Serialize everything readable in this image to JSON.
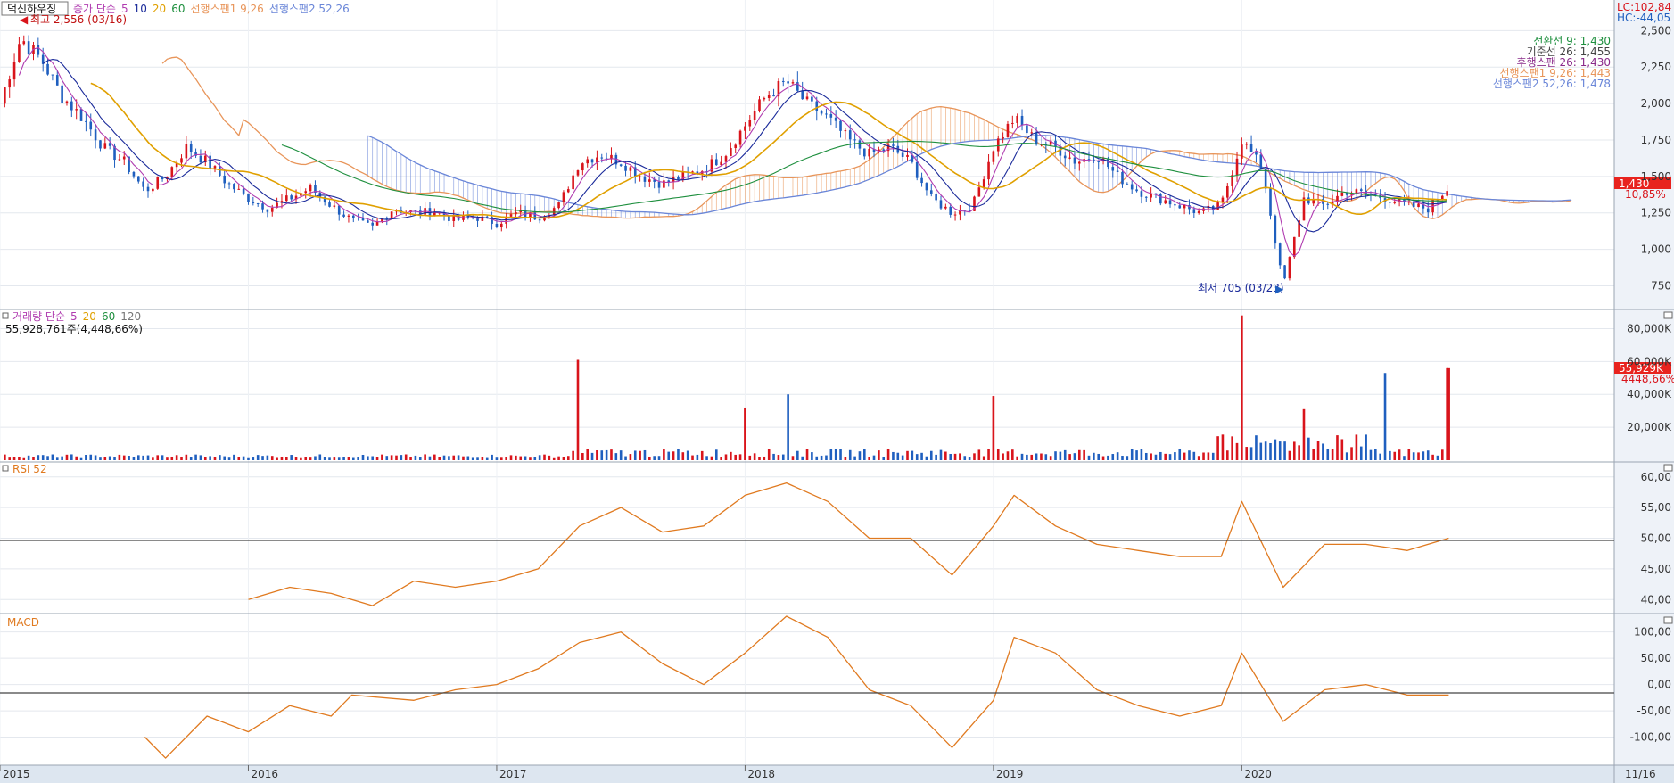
{
  "price_panel": {
    "stock_name": "덕신하우징",
    "legend": [
      {
        "text": "종가 단순",
        "color": "#b03cb0"
      },
      {
        "text": "5",
        "color": "#b03cb0"
      },
      {
        "text": "10",
        "color": "#1a2a9a"
      },
      {
        "text": "20",
        "color": "#e0a000"
      },
      {
        "text": "60",
        "color": "#1e8f3e"
      },
      {
        "text": "선행스팬1 9,26",
        "color": "#e8955a"
      },
      {
        "text": "선행스팬2 52,26",
        "color": "#6a86d8"
      }
    ],
    "high_marker": "최고 2,556 (03/16)",
    "low_marker": "최저 705 (03/23)",
    "lc_label": "LC:102,84",
    "hc_label": "HC:-44,05",
    "info_lines": [
      {
        "text": "전환선 9: 1,430",
        "color": "#1e8f3e"
      },
      {
        "text": "기준선 26: 1,455",
        "color": "#444444"
      },
      {
        "text": "후행스팬 26: 1,430",
        "color": "#8a2a8a"
      },
      {
        "text": "선행스팬1 9,26: 1,443",
        "color": "#e8955a"
      },
      {
        "text": "선행스팬2 52,26: 1,478",
        "color": "#6a86d8"
      }
    ],
    "price_badge": "1,430",
    "pct_label": "10,85%",
    "y_ticks": [
      "2,500",
      "2,250",
      "2,000",
      "1,750",
      "1,500",
      "1,250",
      "1,000",
      "750"
    ]
  },
  "volume_panel": {
    "legend": [
      {
        "text": "거래량 단순",
        "color": "#b03cb0"
      },
      {
        "text": "5",
        "color": "#b03cb0"
      },
      {
        "text": "20",
        "color": "#e0a000"
      },
      {
        "text": "60",
        "color": "#1e8f3e"
      },
      {
        "text": "120",
        "color": "#777777"
      }
    ],
    "summary": "55,928,761주(4,448,66%)",
    "badge": "55,929K",
    "pct_label": "4448,66%",
    "y_ticks": [
      "80,000K",
      "60,000K",
      "40,000K",
      "20,000K"
    ]
  },
  "rsi_panel": {
    "title": "RSI 52",
    "y_ticks": [
      "60,00",
      "55,00",
      "50,00",
      "45,00",
      "40,00"
    ]
  },
  "macd_panel": {
    "title": "MACD",
    "y_ticks": [
      "100,00",
      "50,00",
      "0,00",
      "-50,00",
      "-100,00"
    ]
  },
  "x_axis": {
    "labels": [
      "2015",
      "2016",
      "2017",
      "2018",
      "2019",
      "2020"
    ],
    "right_label": "11/16"
  },
  "colors": {
    "up": "#d9141b",
    "down": "#1f5fbf",
    "rsi": "#e07a20",
    "macd": "#e07a20",
    "badge": "#e8231e"
  },
  "chart_data": [
    {
      "type": "candlestick",
      "x_range": [
        "2015-01",
        "2020-11"
      ],
      "ylim": [
        600,
        2600
      ],
      "close_path": [
        [
          "2015-01",
          2000
        ],
        [
          "2015-02",
          2450
        ],
        [
          "2015-03",
          2300
        ],
        [
          "2015-04",
          2050
        ],
        [
          "2015-05",
          1900
        ],
        [
          "2015-06",
          1700
        ],
        [
          "2015-07",
          1600
        ],
        [
          "2015-08",
          1400
        ],
        [
          "2015-09",
          1500
        ],
        [
          "2015-10",
          1700
        ],
        [
          "2015-11",
          1600
        ],
        [
          "2015-12",
          1450
        ],
        [
          "2016-01",
          1350
        ],
        [
          "2016-02",
          1280
        ],
        [
          "2016-03",
          1350
        ],
        [
          "2016-04",
          1420
        ],
        [
          "2016-05",
          1300
        ],
        [
          "2016-06",
          1200
        ],
        [
          "2016-07",
          1150
        ],
        [
          "2016-08",
          1280
        ],
        [
          "2016-09",
          1250
        ],
        [
          "2016-10",
          1260
        ],
        [
          "2016-11",
          1200
        ],
        [
          "2016-12",
          1220
        ],
        [
          "2017-01",
          1180
        ],
        [
          "2017-02",
          1250
        ],
        [
          "2017-03",
          1220
        ],
        [
          "2017-04",
          1300
        ],
        [
          "2017-05",
          1600
        ],
        [
          "2017-06",
          1650
        ],
        [
          "2017-07",
          1600
        ],
        [
          "2017-08",
          1500
        ],
        [
          "2017-09",
          1450
        ],
        [
          "2017-10",
          1500
        ],
        [
          "2017-11",
          1550
        ],
        [
          "2017-12",
          1650
        ],
        [
          "2018-01",
          1850
        ],
        [
          "2018-02",
          2050
        ],
        [
          "2018-03",
          2150
        ],
        [
          "2018-04",
          2000
        ],
        [
          "2018-05",
          1900
        ],
        [
          "2018-06",
          1750
        ],
        [
          "2018-07",
          1650
        ],
        [
          "2018-08",
          1700
        ],
        [
          "2018-09",
          1600
        ],
        [
          "2018-10",
          1350
        ],
        [
          "2018-11",
          1250
        ],
        [
          "2018-12",
          1300
        ],
        [
          "2019-01",
          1700
        ],
        [
          "2019-02",
          1900
        ],
        [
          "2019-03",
          1750
        ],
        [
          "2019-04",
          1700
        ],
        [
          "2019-05",
          1600
        ],
        [
          "2019-06",
          1650
        ],
        [
          "2019-07",
          1500
        ],
        [
          "2019-08",
          1400
        ],
        [
          "2019-09",
          1350
        ],
        [
          "2019-10",
          1300
        ],
        [
          "2019-11",
          1250
        ],
        [
          "2019-12",
          1300
        ],
        [
          "2020-01",
          1750
        ],
        [
          "2020-02",
          1550
        ],
        [
          "2020-03",
          750
        ],
        [
          "2020-04",
          1350
        ],
        [
          "2020-05",
          1300
        ],
        [
          "2020-06",
          1400
        ],
        [
          "2020-07",
          1380
        ],
        [
          "2020-08",
          1350
        ],
        [
          "2020-09",
          1300
        ],
        [
          "2020-10",
          1280
        ],
        [
          "2020-11",
          1430
        ]
      ],
      "events": [
        {
          "label": "최고",
          "value": 2556,
          "date": "03/16"
        },
        {
          "label": "최저",
          "value": 705,
          "date": "03/23"
        }
      ]
    },
    {
      "type": "bar",
      "series_label": "거래량",
      "ylim_k": [
        0,
        90000
      ],
      "spikes_k": [
        [
          "2017-05",
          61000
        ],
        [
          "2018-01",
          32000
        ],
        [
          "2018-03",
          40000
        ],
        [
          "2019-01",
          39000
        ],
        [
          "2020-01",
          88000
        ],
        [
          "2020-04",
          31000
        ],
        [
          "2020-08",
          53000
        ],
        [
          "2020-11",
          55929
        ]
      ]
    },
    {
      "type": "line",
      "series_label": "RSI 52",
      "ylim": [
        38,
        62
      ],
      "points": [
        [
          "2016-01",
          40
        ],
        [
          "2016-03",
          42
        ],
        [
          "2016-05",
          41
        ],
        [
          "2016-07",
          39
        ],
        [
          "2016-09",
          43
        ],
        [
          "2016-11",
          42
        ],
        [
          "2017-01",
          43
        ],
        [
          "2017-03",
          45
        ],
        [
          "2017-05",
          52
        ],
        [
          "2017-07",
          55
        ],
        [
          "2017-09",
          51
        ],
        [
          "2017-11",
          52
        ],
        [
          "2018-01",
          57
        ],
        [
          "2018-03",
          59
        ],
        [
          "2018-05",
          56
        ],
        [
          "2018-07",
          50
        ],
        [
          "2018-09",
          50
        ],
        [
          "2018-11",
          44
        ],
        [
          "2019-01",
          52
        ],
        [
          "2019-02",
          57
        ],
        [
          "2019-04",
          52
        ],
        [
          "2019-06",
          49
        ],
        [
          "2019-08",
          48
        ],
        [
          "2019-10",
          47
        ],
        [
          "2019-12",
          47
        ],
        [
          "2020-01",
          56
        ],
        [
          "2020-03",
          42
        ],
        [
          "2020-05",
          49
        ],
        [
          "2020-07",
          49
        ],
        [
          "2020-09",
          48
        ],
        [
          "2020-11",
          50
        ]
      ]
    },
    {
      "type": "line",
      "series_label": "MACD",
      "ylim": [
        -150,
        130
      ],
      "points": [
        [
          "2015-08",
          -100
        ],
        [
          "2015-09",
          -140
        ],
        [
          "2015-11",
          -60
        ],
        [
          "2016-01",
          -90
        ],
        [
          "2016-03",
          -40
        ],
        [
          "2016-05",
          -60
        ],
        [
          "2016-06",
          -20
        ],
        [
          "2016-09",
          -30
        ],
        [
          "2016-11",
          -10
        ],
        [
          "2017-01",
          0
        ],
        [
          "2017-03",
          30
        ],
        [
          "2017-05",
          80
        ],
        [
          "2017-07",
          100
        ],
        [
          "2017-09",
          40
        ],
        [
          "2017-11",
          0
        ],
        [
          "2018-01",
          60
        ],
        [
          "2018-03",
          130
        ],
        [
          "2018-05",
          90
        ],
        [
          "2018-07",
          -10
        ],
        [
          "2018-09",
          -40
        ],
        [
          "2018-11",
          -120
        ],
        [
          "2019-01",
          -30
        ],
        [
          "2019-02",
          90
        ],
        [
          "2019-04",
          60
        ],
        [
          "2019-06",
          -10
        ],
        [
          "2019-08",
          -40
        ],
        [
          "2019-10",
          -60
        ],
        [
          "2019-12",
          -40
        ],
        [
          "2020-01",
          60
        ],
        [
          "2020-03",
          -70
        ],
        [
          "2020-05",
          -10
        ],
        [
          "2020-07",
          0
        ],
        [
          "2020-09",
          -20
        ],
        [
          "2020-11",
          -20
        ]
      ]
    }
  ]
}
